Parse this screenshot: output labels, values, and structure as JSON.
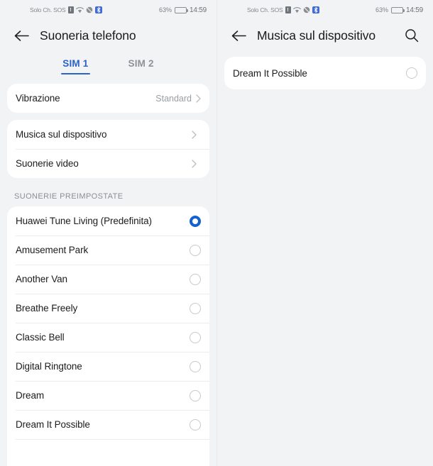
{
  "status_bar": {
    "carrier": "Solo Ch. SOS",
    "icons": [
      "signal-alert-icon",
      "wifi-icon",
      "mute-icon",
      "bluetooth-badge-icon"
    ],
    "battery_percent": "63%",
    "battery_level": 63,
    "time": "14:59"
  },
  "left_screen": {
    "title": "Suoneria telefono",
    "back_icon": "back-arrow-icon",
    "tabs": [
      {
        "label": "SIM 1",
        "active": true
      },
      {
        "label": "SIM 2",
        "active": false
      }
    ],
    "vibration_card": {
      "label": "Vibrazione",
      "value": "Standard",
      "chevron": "chevron-right-icon"
    },
    "source_card": [
      {
        "label": "Musica sul dispositivo",
        "chevron": "chevron-right-icon"
      },
      {
        "label": "Suonerie video",
        "chevron": "chevron-right-icon"
      }
    ],
    "section_header": "SUONERIE PREIMPOSTATE",
    "ringtones": [
      {
        "label": "Huawei Tune Living (Predefinita)",
        "selected": true
      },
      {
        "label": "Amusement Park",
        "selected": false
      },
      {
        "label": "Another Van",
        "selected": false
      },
      {
        "label": "Breathe Freely",
        "selected": false
      },
      {
        "label": "Classic Bell",
        "selected": false
      },
      {
        "label": "Digital Ringtone",
        "selected": false
      },
      {
        "label": "Dream",
        "selected": false
      },
      {
        "label": "Dream It Possible",
        "selected": false
      }
    ]
  },
  "right_screen": {
    "title": "Musica sul dispositivo",
    "back_icon": "back-arrow-icon",
    "search_icon": "search-icon",
    "items": [
      {
        "label": "Dream It Possible",
        "selected": false
      }
    ]
  },
  "colors": {
    "accent": "#2b62c6",
    "radio_selected": "#1461d2",
    "page_background": "#f1f3f4",
    "card_background": "#ffffff",
    "primary_text": "#1c1c1c",
    "secondary_text": "#8b8f94"
  }
}
